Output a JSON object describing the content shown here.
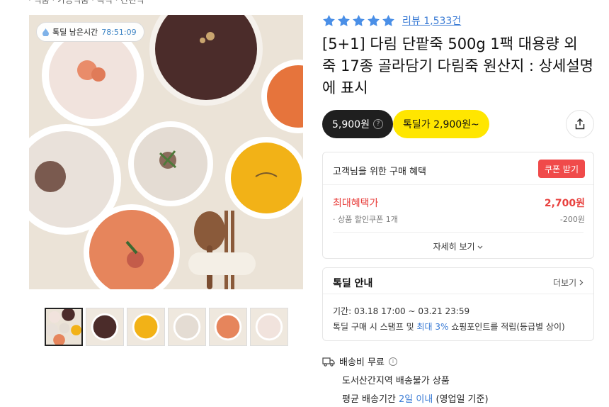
{
  "breadcrumb": "· 식품 · 가공식품 · 즉석 · 간편식",
  "image": {
    "timer_label": "톡딜 남은시간",
    "timer_value": "78:51:09"
  },
  "thumbnails": [
    "thumb-1",
    "thumb-2",
    "thumb-3",
    "thumb-4",
    "thumb-5",
    "thumb-6"
  ],
  "rating": {
    "stars": 5,
    "review_text": "리뷰 1,533건",
    "star_color": "#4a8fe7"
  },
  "product": {
    "title": "[5+1] 다림 단팥죽 500g 1팩 대용량 외 죽 17종 골라담기 다림죽 원산지 : 상세설명에 표시"
  },
  "price": {
    "regular": "5,900원",
    "regular_help": "?",
    "deal": "톡딜가 2,900원~"
  },
  "benefit": {
    "heading": "고객님을 위한 구매 혜택",
    "coupon_button": "쿠폰 받기",
    "max_label": "최대혜택가",
    "max_value": "2,700원",
    "coupon_line": "· 상품 할인쿠폰 1개",
    "coupon_amount": "-200원",
    "detail_button": "자세히 보기"
  },
  "deal_info": {
    "heading": "톡딜 안내",
    "more": "더보기",
    "period": "기간: 03.18 17:00 ~ 03.21 23:59",
    "note_prefix": "톡딜 구매 시 스탬프 및 ",
    "note_highlight": "최대 3%",
    "note_suffix": " 쇼핑포인트를 적립(등급별 상이)"
  },
  "shipping": {
    "fee_label": "배송비 무료",
    "restriction": "도서산간지역 배송불가 상품",
    "period_prefix": "평균 배송기간 ",
    "period_highlight": "2일 이내",
    "period_suffix": " (영업일 기준)"
  },
  "colors": {
    "accent_blue": "#3a7bd5",
    "deal_yellow": "#ffe600",
    "coupon_red": "#f04a4a",
    "price_red": "#e8413e"
  }
}
